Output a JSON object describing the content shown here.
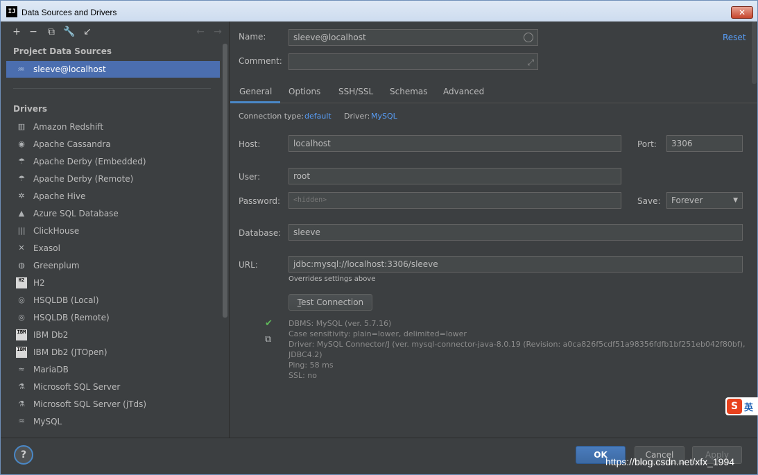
{
  "window": {
    "title": "Data Sources and Drivers",
    "app_icon": "IJ",
    "close_glyph": "✕"
  },
  "left": {
    "toolbar_icons": [
      "add-icon",
      "remove-icon",
      "duplicate-icon",
      "wrench-icon",
      "import-icon",
      "back-icon",
      "forward-icon"
    ],
    "project_header": "Project Data Sources",
    "selected_source": "sleeve@localhost",
    "drivers_header": "Drivers",
    "drivers": [
      {
        "label": "Amazon Redshift",
        "icon": "▥"
      },
      {
        "label": "Apache Cassandra",
        "icon": "◉"
      },
      {
        "label": "Apache Derby (Embedded)",
        "icon": "☂"
      },
      {
        "label": "Apache Derby (Remote)",
        "icon": "☂"
      },
      {
        "label": "Apache Hive",
        "icon": "✲"
      },
      {
        "label": "Azure SQL Database",
        "icon": "▲"
      },
      {
        "label": "ClickHouse",
        "icon": "|||"
      },
      {
        "label": "Exasol",
        "icon": "✕"
      },
      {
        "label": "Greenplum",
        "icon": "◍"
      },
      {
        "label": "H2",
        "icon": "H2"
      },
      {
        "label": "HSQLDB (Local)",
        "icon": "◎"
      },
      {
        "label": "HSQLDB (Remote)",
        "icon": "◎"
      },
      {
        "label": "IBM Db2",
        "icon": "IBM"
      },
      {
        "label": "IBM Db2 (JTOpen)",
        "icon": "IBM"
      },
      {
        "label": "MariaDB",
        "icon": "≈"
      },
      {
        "label": "Microsoft SQL Server",
        "icon": "⚗"
      },
      {
        "label": "Microsoft SQL Server (jTds)",
        "icon": "⚗"
      },
      {
        "label": "MySQL",
        "icon": "♒"
      }
    ]
  },
  "form": {
    "name_label": "Name:",
    "name_value": "sleeve@localhost",
    "comment_label": "Comment:",
    "comment_value": "",
    "reset_label": "Reset",
    "tabs": [
      "General",
      "Options",
      "SSH/SSL",
      "Schemas",
      "Advanced"
    ],
    "connection_type_label": "Connection type:",
    "connection_type_value": "default",
    "driver_label": "Driver:",
    "driver_value": "MySQL",
    "host_label": "Host:",
    "host_value": "localhost",
    "port_label": "Port:",
    "port_value": "3306",
    "user_label": "User:",
    "user_value": "root",
    "password_label": "Password:",
    "password_placeholder": "<hidden>",
    "save_label": "Save:",
    "save_value": "Forever",
    "database_label": "Database:",
    "database_value": "sleeve",
    "url_label": "URL:",
    "url_value": "jdbc:mysql://localhost:3306/sleeve",
    "url_note": "Overrides settings above",
    "test_button_prefix": "T",
    "test_button_rest": "est Connection",
    "result_lines": [
      "DBMS: MySQL (ver. 5.7.16)",
      "Case sensitivity: plain=lower, delimited=lower",
      "Driver: MySQL Connector/J (ver. mysql-connector-java-8.0.19 (Revision: a0ca826f5cdf51a98356fdfb1bf251eb042f80bf),",
      "JDBC4.2)",
      "Ping: 58 ms",
      "SSL: no"
    ]
  },
  "footer": {
    "help": "?",
    "ok": "OK",
    "cancel": "Cancel",
    "apply": "Apply",
    "watermark": "https://blog.csdn.net/xfx_1994"
  },
  "ime": {
    "s": "S",
    "t": "英"
  },
  "colors": {
    "accent": "#4b6eaf",
    "link": "#589df6",
    "ok": "#4a7cbd",
    "success": "#5fb85a"
  }
}
